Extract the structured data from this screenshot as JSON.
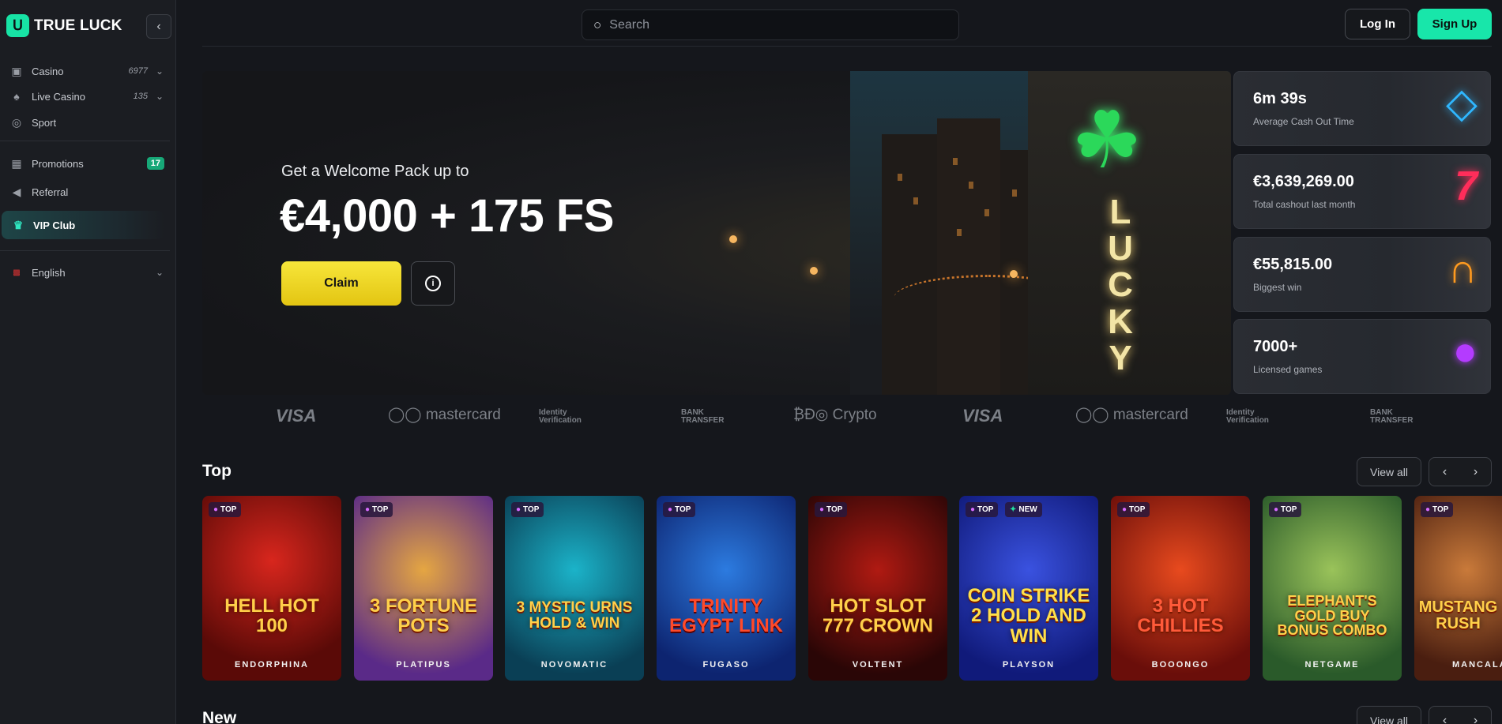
{
  "brand": {
    "name": "TRUE LUCK"
  },
  "sidebar": {
    "items": [
      {
        "label": "Casino",
        "count": "6977"
      },
      {
        "label": "Live Casino",
        "count": "135"
      },
      {
        "label": "Sport"
      },
      {
        "label": "Promotions",
        "badge": "17"
      },
      {
        "label": "Referral"
      },
      {
        "label": "VIP Club"
      },
      {
        "label": "English"
      }
    ]
  },
  "header": {
    "search_placeholder": "Search",
    "login_label": "Log In",
    "signup_label": "Sign Up"
  },
  "hero": {
    "subtitle": "Get a Welcome Pack up to",
    "title": "€4,000 + 175 FS",
    "claim_label": "Claim",
    "sign_text": "LUCKY"
  },
  "stats": [
    {
      "value": "6m 39s",
      "label": "Average Cash Out Time",
      "icon": "diamond-icon",
      "color": "#2fb7ff"
    },
    {
      "value": "€3,639,269.00",
      "label": "Total cashout last month",
      "icon": "seven-icon",
      "color": "#ff2d5a"
    },
    {
      "value": "€55,815.00",
      "label": "Biggest win",
      "icon": "horseshoe-icon",
      "color": "#ff9a1f"
    },
    {
      "value": "7000+",
      "label": "Licensed games",
      "icon": "plum-icon",
      "color": "#b43bff"
    }
  ],
  "payments": [
    "VISA",
    "mastercard",
    "Identity Verification",
    "BANK TRANSFER",
    "Crypto",
    "VISA",
    "mastercard",
    "Identity Verification",
    "BANK TRANSFER"
  ],
  "sections": {
    "top": {
      "title": "Top",
      "view_all": "View all"
    },
    "new": {
      "title": "New",
      "view_all": "View all"
    }
  },
  "games": [
    {
      "name": "HELL HOT 100",
      "provider": "ENDORPHINA",
      "tags": [
        "TOP"
      ]
    },
    {
      "name": "3 FORTUNE POTS",
      "provider": "PLATIPUS",
      "tags": [
        "TOP"
      ]
    },
    {
      "name": "3 MYSTIC URNS HOLD & WIN",
      "provider": "NOVOMATIC",
      "tags": [
        "TOP"
      ]
    },
    {
      "name": "TRINITY EGYPT LINK",
      "provider": "FUGASO",
      "tags": [
        "TOP"
      ]
    },
    {
      "name": "HOT SLOT 777 CROWN",
      "provider": "VOLTENT",
      "tags": [
        "TOP"
      ]
    },
    {
      "name": "COIN STRIKE 2 HOLD AND WIN",
      "provider": "PLAYSON",
      "tags": [
        "TOP",
        "NEW"
      ]
    },
    {
      "name": "3 HOT CHILLIES",
      "provider": "BOOONGO",
      "tags": [
        "TOP"
      ]
    },
    {
      "name": "ELEPHANT'S GOLD BUY BONUS COMBO",
      "provider": "NETGAME",
      "tags": [
        "TOP"
      ]
    },
    {
      "name": "MUSTANG RUSH",
      "provider": "MANCALA",
      "tags": [
        "TOP"
      ]
    }
  ]
}
